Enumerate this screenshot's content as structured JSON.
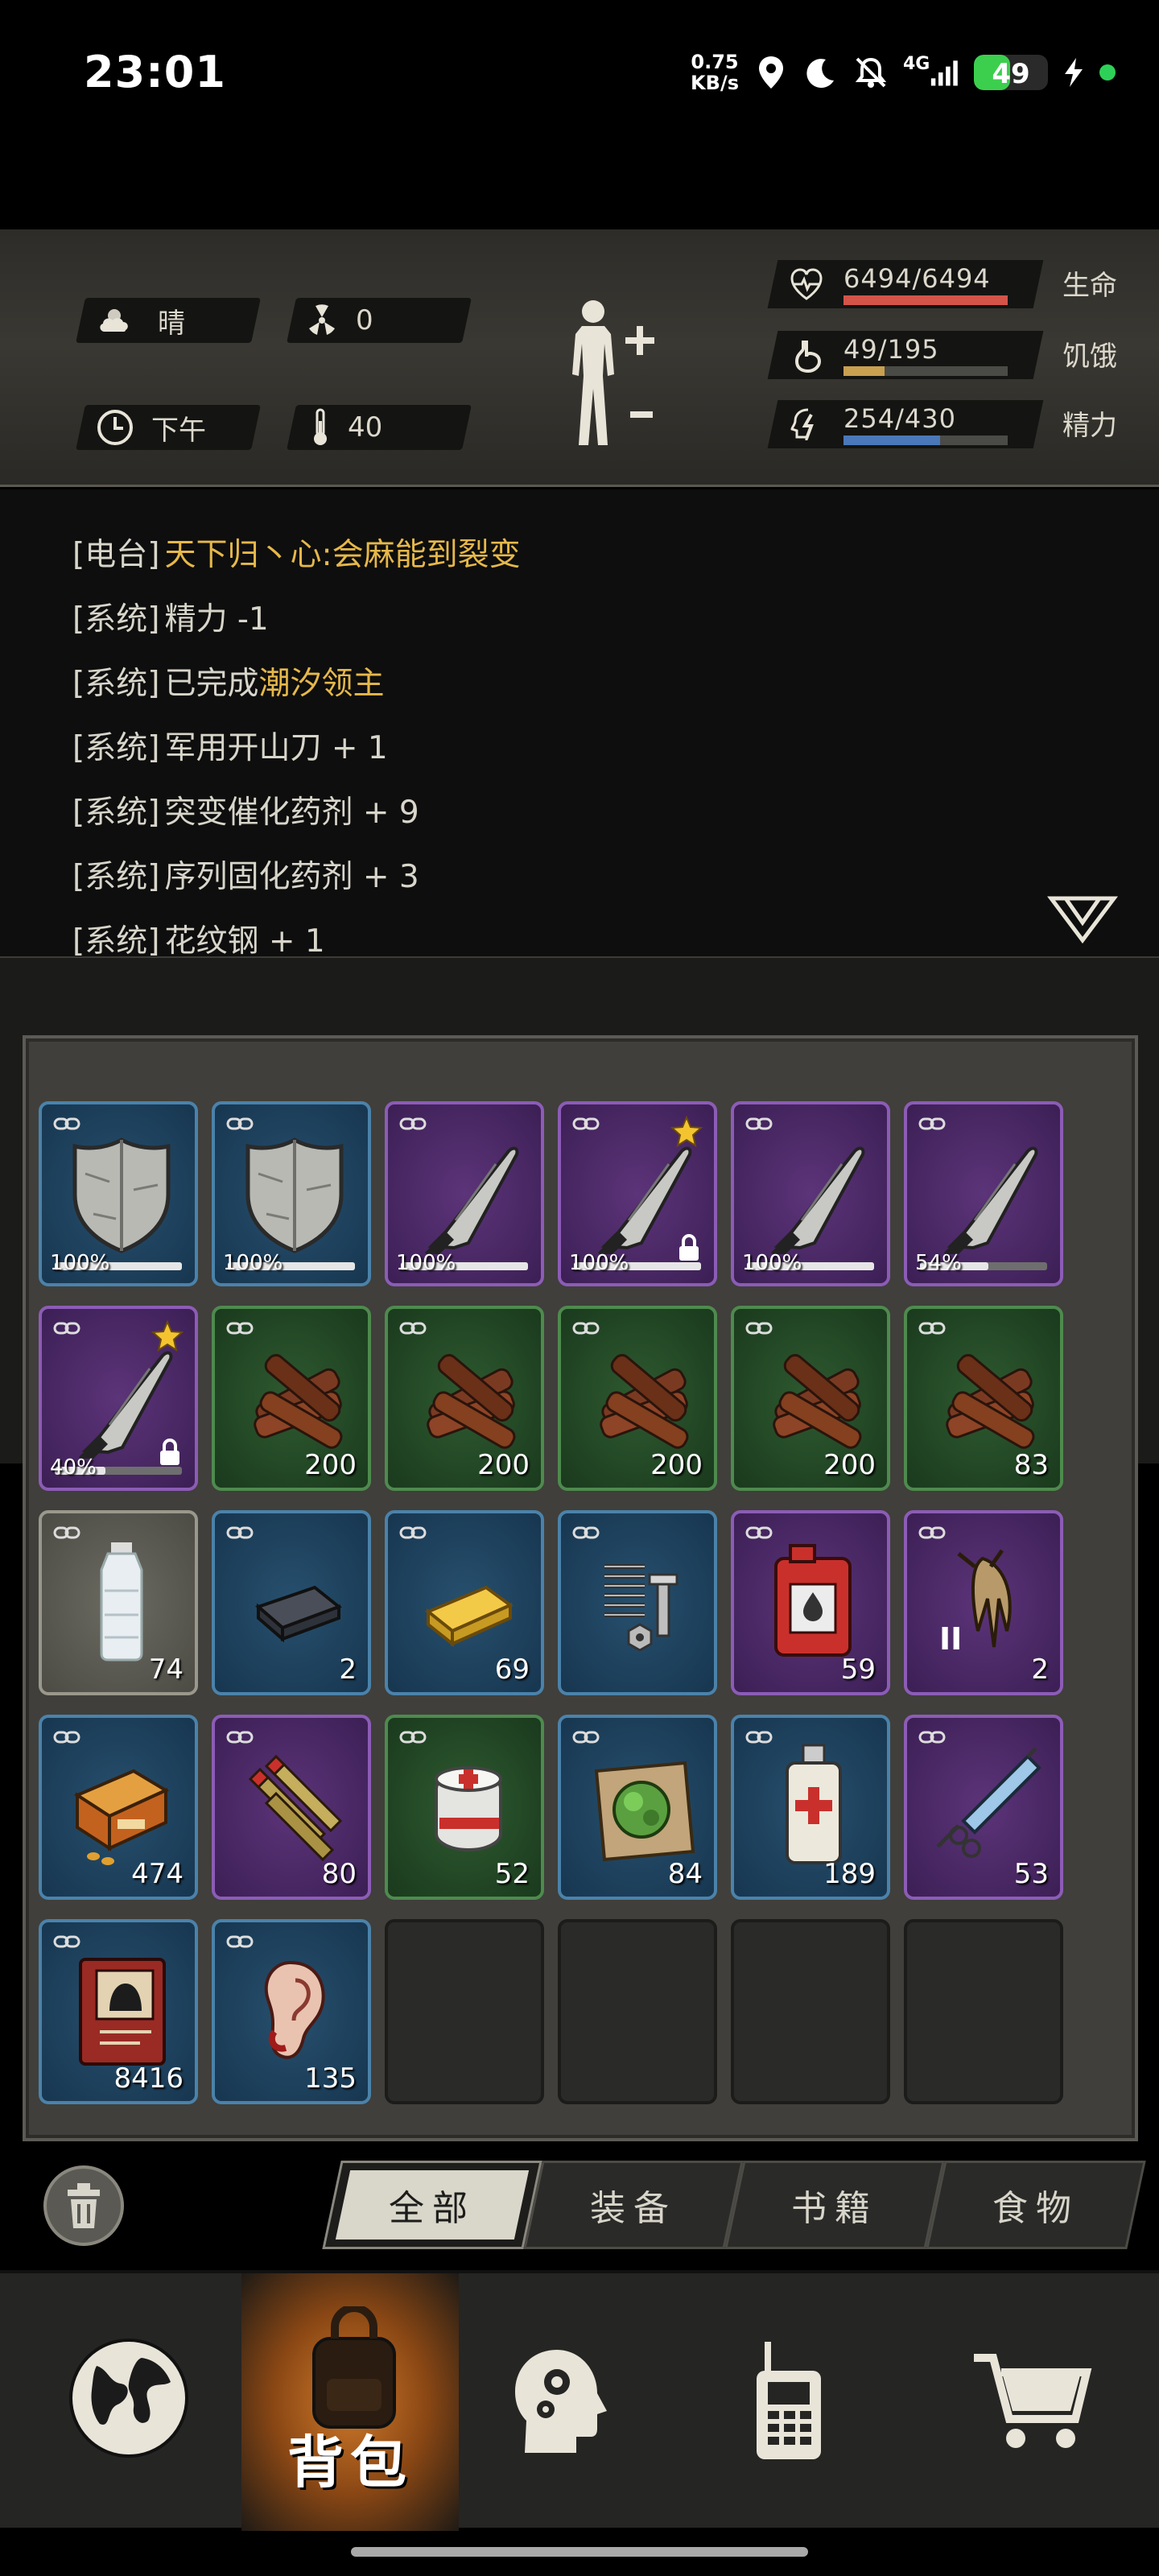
{
  "status_bar": {
    "time": "23:01",
    "speed_value": "0.75",
    "speed_unit": "KB/s",
    "network": "4G",
    "battery": "49",
    "battery_level": 0.49,
    "icons": [
      "location-icon",
      "moon-icon",
      "bell-off-icon",
      "signal-icon",
      "charging-icon"
    ]
  },
  "environment": {
    "weather": "晴",
    "radiation": "0",
    "time_of_day": "下午",
    "temperature": "40"
  },
  "stats": {
    "health": {
      "value": "6494/6494",
      "label": "生命",
      "ratio": 1.0,
      "color": "#d4544a"
    },
    "hunger": {
      "value": "49/195",
      "label": "饥饿",
      "ratio": 0.25,
      "color": "#c8a050"
    },
    "energy": {
      "value": "254/430",
      "label": "精力",
      "ratio": 0.59,
      "color": "#4a78b8"
    }
  },
  "log": [
    {
      "tag": "[电台]",
      "text": "天下归丶心:会麻能到裂变",
      "highlight": "",
      "tail": ""
    },
    {
      "tag": "[系统]",
      "text": "精力 -1",
      "highlight": "",
      "tail": ""
    },
    {
      "tag": "[系统]",
      "text": "已完成",
      "highlight": "潮汐领主",
      "tail": ""
    },
    {
      "tag": "[系统]",
      "text": "军用开山刀 + 1",
      "highlight": "",
      "tail": ""
    },
    {
      "tag": "[系统]",
      "text": "突变催化药剂 + 9",
      "highlight": "",
      "tail": ""
    },
    {
      "tag": "[系统]",
      "text": "序列固化药剂 + 3",
      "highlight": "",
      "tail": ""
    },
    {
      "tag": "[系统]",
      "text": "花纹钢 + 1",
      "highlight": "",
      "tail": ""
    }
  ],
  "inventory": [
    {
      "item": "shield",
      "rarity": "blue",
      "durability": "100%",
      "durability_ratio": 1.0
    },
    {
      "item": "shield",
      "rarity": "blue",
      "durability": "100%",
      "durability_ratio": 1.0
    },
    {
      "item": "machete",
      "rarity": "purple",
      "durability": "100%",
      "durability_ratio": 1.0
    },
    {
      "item": "machete",
      "rarity": "purple",
      "durability": "100%",
      "durability_ratio": 1.0,
      "star": true,
      "locked": true
    },
    {
      "item": "machete",
      "rarity": "purple",
      "durability": "100%",
      "durability_ratio": 1.0
    },
    {
      "item": "machete",
      "rarity": "purple",
      "durability": "54%",
      "durability_ratio": 0.54
    },
    {
      "item": "machete",
      "rarity": "purple",
      "durability": "40%",
      "durability_ratio": 0.4,
      "star": true,
      "locked": true
    },
    {
      "item": "wood",
      "rarity": "green",
      "qty": "200"
    },
    {
      "item": "wood",
      "rarity": "green",
      "qty": "200"
    },
    {
      "item": "wood",
      "rarity": "green",
      "qty": "200"
    },
    {
      "item": "wood",
      "rarity": "green",
      "qty": "200"
    },
    {
      "item": "wood",
      "rarity": "green",
      "qty": "83"
    },
    {
      "item": "water-bottle",
      "rarity": "grey",
      "qty": "74"
    },
    {
      "item": "iron-ingot",
      "rarity": "blue",
      "qty": "2"
    },
    {
      "item": "gold-bar",
      "rarity": "blue",
      "qty": "69"
    },
    {
      "item": "spring-bolt",
      "rarity": "blue",
      "qty": ""
    },
    {
      "item": "fuel-can",
      "rarity": "purple",
      "qty": "59"
    },
    {
      "item": "mutant-claw",
      "rarity": "purple",
      "qty": "2",
      "tier": "II"
    },
    {
      "item": "ammo-box",
      "rarity": "blue",
      "qty": "474"
    },
    {
      "item": "rifle-ammo",
      "rarity": "purple",
      "qty": "80"
    },
    {
      "item": "bandage",
      "rarity": "green",
      "qty": "52"
    },
    {
      "item": "herb-map",
      "rarity": "blue",
      "qty": "84"
    },
    {
      "item": "spray-medicine",
      "rarity": "blue",
      "qty": "189"
    },
    {
      "item": "syringe",
      "rarity": "purple",
      "qty": "53"
    },
    {
      "item": "book",
      "rarity": "blue",
      "qty": "8416"
    },
    {
      "item": "ear",
      "rarity": "blue",
      "qty": "135"
    },
    {
      "item": "",
      "rarity": "empty"
    },
    {
      "item": "",
      "rarity": "empty"
    },
    {
      "item": "",
      "rarity": "empty"
    },
    {
      "item": "",
      "rarity": "empty"
    }
  ],
  "tabs": [
    {
      "label": "全部",
      "active": true
    },
    {
      "label": "装备",
      "active": false
    },
    {
      "label": "书籍",
      "active": false
    },
    {
      "label": "食物",
      "active": false
    }
  ],
  "nav": [
    {
      "name": "world-map",
      "icon": "globe-icon",
      "label": "",
      "active": false
    },
    {
      "name": "backpack",
      "icon": "backpack-icon",
      "label": "背包",
      "active": true
    },
    {
      "name": "skills",
      "icon": "head-gears-icon",
      "label": "",
      "active": false
    },
    {
      "name": "radio",
      "icon": "walkie-talkie-icon",
      "label": "",
      "active": false
    },
    {
      "name": "shop",
      "icon": "cart-icon",
      "label": "",
      "active": false
    }
  ]
}
